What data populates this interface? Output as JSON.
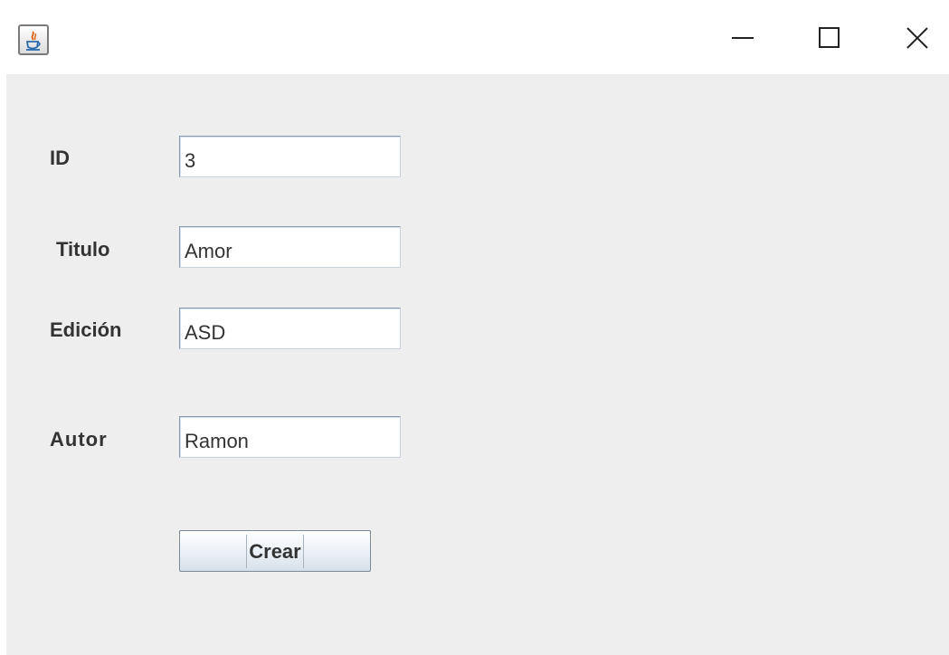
{
  "window": {
    "icon": "java-cup-icon",
    "controls": {
      "minimize_icon": "minimize-icon",
      "maximize_icon": "maximize-icon",
      "close_icon": "close-icon"
    }
  },
  "form": {
    "fields": [
      {
        "label": "ID",
        "value": "3"
      },
      {
        "label": "Titulo",
        "value": "Amor"
      },
      {
        "label": "Edición",
        "value": "ASD"
      },
      {
        "label": "Autor",
        "value": "Ramon"
      }
    ],
    "submit_label": "Crear"
  },
  "colors": {
    "panel_background": "#eeeeee",
    "label_text": "#333333",
    "field_border": "#8a9bb1"
  }
}
